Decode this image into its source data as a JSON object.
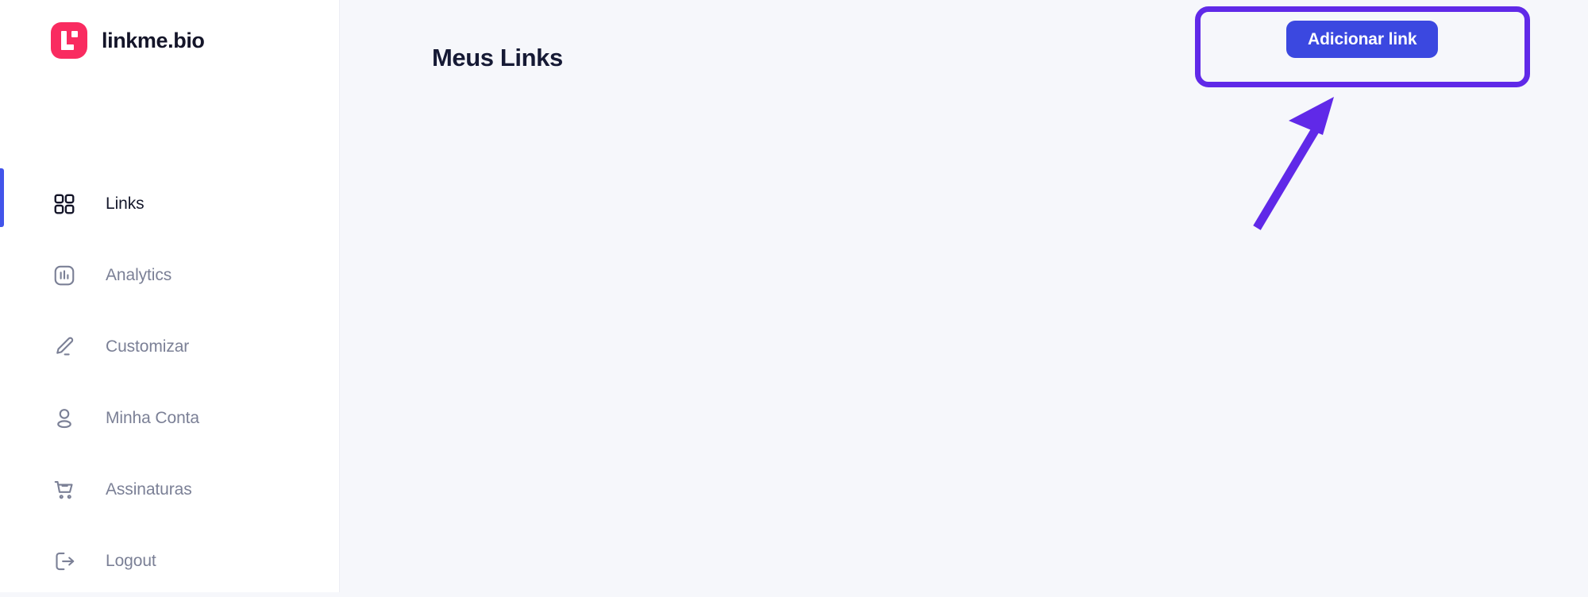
{
  "brand": {
    "name": "linkme.bio",
    "mark_color": "#f92b60",
    "icon": "linkme-logo-mark"
  },
  "sidebar": {
    "items": [
      {
        "id": "links",
        "label": "Links",
        "icon": "grid-icon",
        "active": true
      },
      {
        "id": "analytics",
        "label": "Analytics",
        "icon": "bar-chart-icon",
        "active": false
      },
      {
        "id": "customizar",
        "label": "Customizar",
        "icon": "pencil-icon",
        "active": false
      },
      {
        "id": "minha-conta",
        "label": "Minha Conta",
        "icon": "user-icon",
        "active": false
      },
      {
        "id": "assinaturas",
        "label": "Assinaturas",
        "icon": "cart-icon",
        "active": false
      },
      {
        "id": "logout",
        "label": "Logout",
        "icon": "logout-icon",
        "active": false
      }
    ],
    "active_indicator_color": "#4254ea"
  },
  "header": {
    "title": "Meus Links"
  },
  "actions": {
    "add_link_label": "Adicionar link",
    "add_link_color": "#3b48e0"
  },
  "annotation": {
    "highlight_color": "#6029e8",
    "arrow_color": "#6029e8",
    "arrow_points_to": "add-link-button"
  },
  "colors": {
    "main_background": "#f6f7fb",
    "sidebar_background": "#ffffff",
    "text_primary": "#161a35",
    "text_muted": "#7b8096"
  }
}
